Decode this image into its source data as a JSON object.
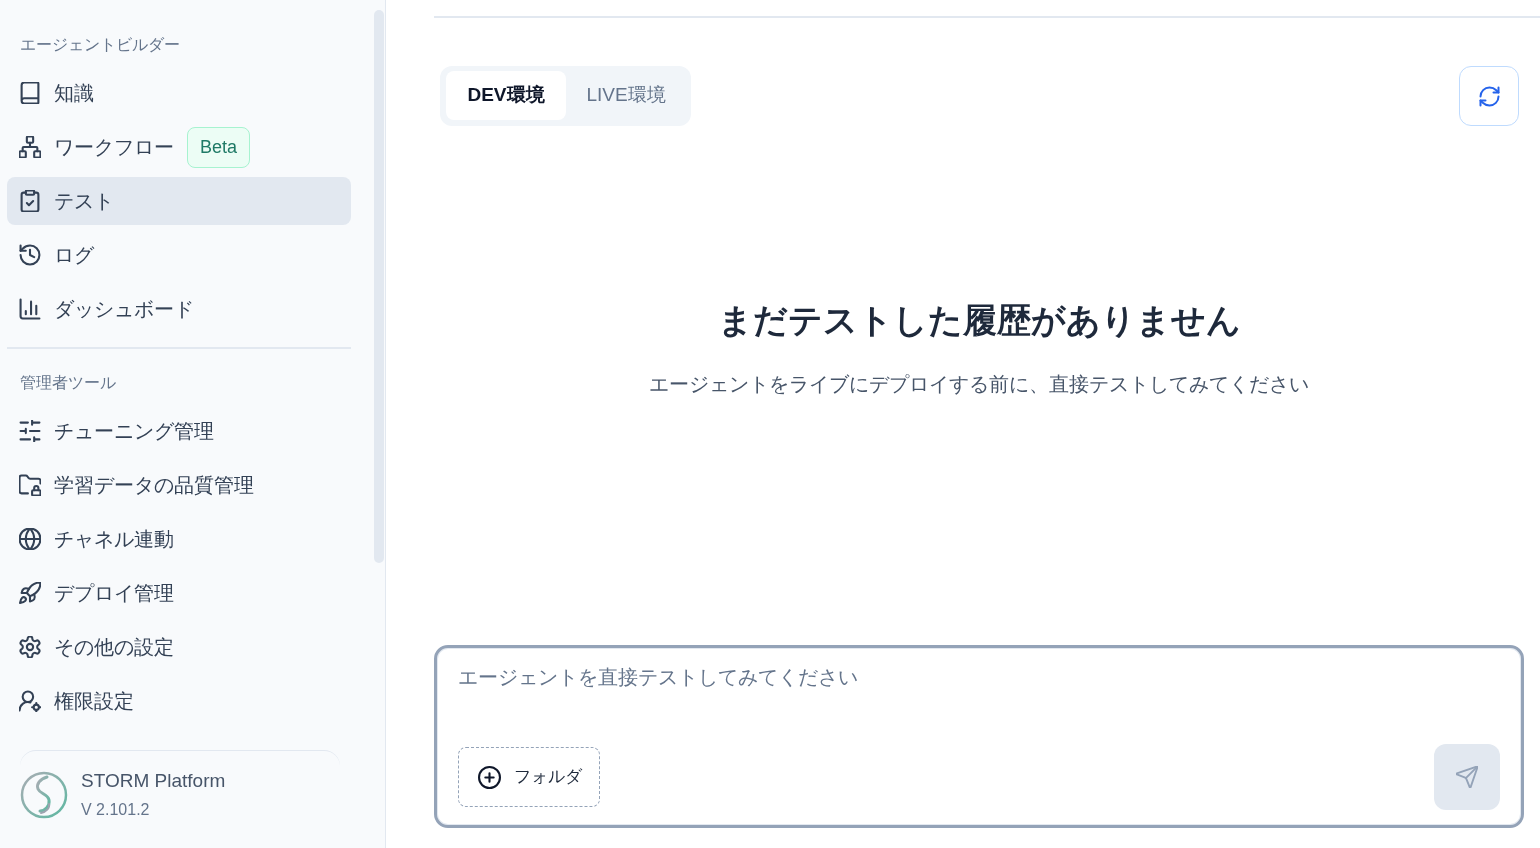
{
  "sidebar": {
    "sections": [
      {
        "title": "エージェントビルダー",
        "items": [
          {
            "label": "知識",
            "selected": false
          },
          {
            "label": "ワークフロー",
            "badge": "Beta",
            "selected": false
          },
          {
            "label": "テスト",
            "selected": true
          },
          {
            "label": "ログ",
            "selected": false
          },
          {
            "label": "ダッシュボード",
            "selected": false
          }
        ]
      },
      {
        "title": "管理者ツール",
        "items": [
          {
            "label": "チューニング管理",
            "selected": false
          },
          {
            "label": "学習データの品質管理",
            "selected": false
          },
          {
            "label": "チャネル連動",
            "selected": false
          },
          {
            "label": "デプロイ管理",
            "selected": false
          },
          {
            "label": "その他の設定",
            "selected": false
          },
          {
            "label": "権限設定",
            "selected": false
          }
        ]
      }
    ],
    "platform": {
      "name": "STORM Platform",
      "version": "V 2.101.2"
    }
  },
  "environment_tabs": [
    {
      "label": "DEV環境",
      "selected": true
    },
    {
      "label": "LIVE環境",
      "selected": false
    }
  ],
  "empty_state": {
    "title": "まだテストした履歴がありません",
    "message": "エージェントをライブにデプロイする前に、直接テストしてみてください"
  },
  "composer": {
    "placeholder": "エージェントを直接テストしてみてください",
    "folder_button": "フォルダ"
  }
}
